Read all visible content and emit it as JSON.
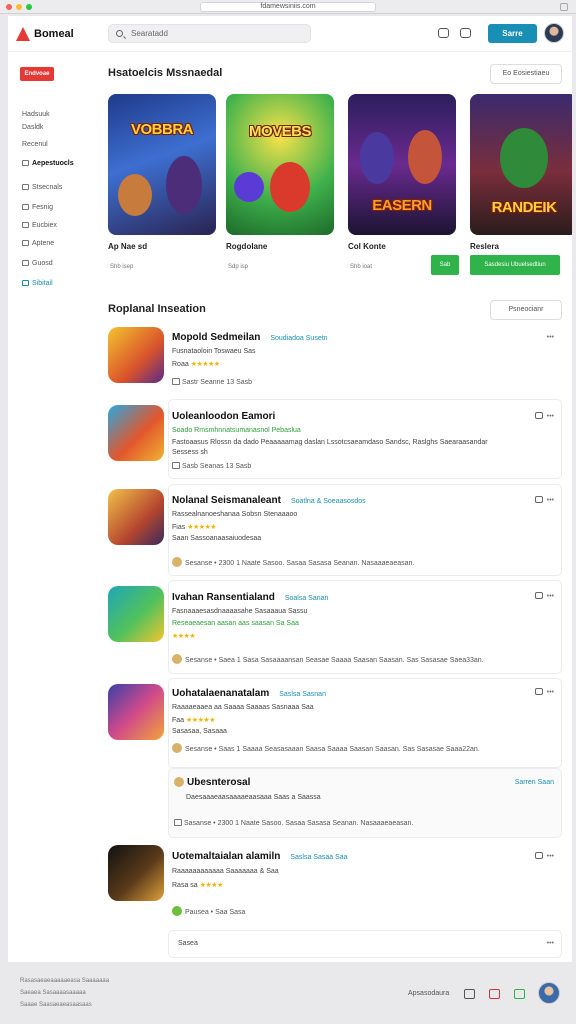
{
  "browser": {
    "url": "fdamewsiniis.com"
  },
  "topbar": {
    "logo_text": "Bomeal",
    "search_placeholder": "Searatadd",
    "primary_button": "Sarre"
  },
  "sidebar": {
    "badge": "Endvoae",
    "items": [
      {
        "label": "Hadsuuk",
        "icon": "",
        "active": false
      },
      {
        "label": "Dasldk",
        "icon": "",
        "active": false
      },
      {
        "label": "Recenul",
        "icon": "",
        "active": false
      },
      {
        "label": "Aepestuocls",
        "icon": "gamepad-icon",
        "active": true
      },
      {
        "label": "Stsecnals",
        "icon": "grid-icon",
        "active": false
      },
      {
        "label": "Fesnig",
        "icon": "folder-icon",
        "active": false
      },
      {
        "label": "Eucbiex",
        "icon": "book-icon",
        "active": false
      },
      {
        "label": "Aptene",
        "icon": "list-icon",
        "active": false
      },
      {
        "label": "Guosd",
        "icon": "gear-icon",
        "active": false
      },
      {
        "label": "Sibitail",
        "icon": "link-icon",
        "active": false
      }
    ]
  },
  "featured": {
    "title": "Hsatoelcis Mssnaedal",
    "action": "Eo Eosiestiaeu",
    "cards": [
      {
        "art_text": "VOBBRA",
        "name": "Ap Nae sd",
        "meta": "Shb isep",
        "button": ""
      },
      {
        "art_text": "MOVEBS",
        "name": "Rogdolane",
        "meta": "Sdp isp",
        "button": ""
      },
      {
        "art_text": "EASERN",
        "name": "Col Konte",
        "meta": "Shb ioat",
        "button": "Sab"
      },
      {
        "art_text": "RANDEIK",
        "name": "Reslera",
        "meta": "",
        "button": "Sasdesiu Ubuelsedtiun"
      }
    ]
  },
  "list": {
    "title": "Roplanal Inseation",
    "action": "Psneocianr",
    "rows": [
      {
        "title": "Mopold Sedmeilan",
        "tag": "Soudiadoa Susetn",
        "line1": "Fusnataoloin Toswaeu Sas",
        "line2": "Roaa",
        "stars": "★★★★★",
        "line3": "",
        "actions": "Sastr Seanne 13 Sasb"
      },
      {
        "title": "Uoleanloodon Eamori",
        "tag": "",
        "line1": "Soado Rmsmhnnatsumanasnol Pebaslua",
        "line2": "Fastoaasus Rlossn da dado Peaaaaamag daslan Lssotcsaeamdaso Sandsc, Raslghs Saearaasandar",
        "stars": "",
        "line3": "Sessess sh",
        "actions": "Sasb Seanas 13 Sasb"
      },
      {
        "title": "Nolanal Seismanaleant",
        "tag": "Soatlna & Soeaasosdos",
        "line1": "Rassealnanoeshanaa Sobsn Stenaaaoo",
        "line2": "Fias",
        "stars": "★★★★★",
        "line3": "Saan Sassoanaasaiuodesaa",
        "actions": "Sesanse • 2300 1 Naate Sasoo. Sasaa Sasasa Seanan. Nasaaaeaeasan."
      },
      {
        "title": "Ivahan Ransentialand",
        "tag": "Soalsa Sanan",
        "line1": "Fasnaaaesasdnaaaasahe Sasaaaua Sassu",
        "line2": "Reseaeaesan aasan aas saasan Sa Saa",
        "stars": "★★★★",
        "line3": "",
        "actions": "Sesanse • Saea 1 Sasa Sasaaaansan Seasae Saaaa Saasan Saasan. Sas Sasasae Saea33an."
      },
      {
        "title": "Uohatalaenanatalam",
        "tag": "Saslsa Sasnan",
        "line1": "Raaaaeaaea aa Saaaa Saaaas Sasnaaa Saa",
        "line2": "Faa",
        "stars": "★★★★★",
        "line3": "Sasasaa, Sasaaa",
        "actions": "Sesanse • Saas 1 Saaaa Seasasaaan Saasa Saaaa Saasan Saasan. Sas Sasasae Saaa22an."
      },
      {
        "title": "Uotemaltaialan alamiln",
        "tag": "Saslsa Sasaa Saa",
        "line1": "Raaaaaaaaaaaa Saaaaaaa & Saa",
        "line2": "Rasa sa",
        "stars": "★★★★",
        "line3": "",
        "actions": "Pausea • Saa Sasa"
      }
    ],
    "subcard": {
      "title": "Ubesnterosal",
      "action": "Sarren Saan",
      "line": "Daesaaaeaasaaaaeaasaaa Saas a Saassa",
      "actions": "Sasanse • 2300 1 Naate Sasoo. Sasaa Sasasa Seanan. Nasaaaeaeasan."
    },
    "load_more": "Sasea"
  },
  "footer": {
    "lines": [
      "Rasasaeaeaaaaaeasa Saaaaaaa",
      "Saeaea Sasaaaasaaaaa",
      "Saaae Saasaeaeasaasaas"
    ],
    "label": "Apsasodaura"
  },
  "colors": {
    "accent": "#1a8fb5",
    "brand": "#e53935",
    "install": "#2fb34a",
    "star": "#f2b400"
  }
}
